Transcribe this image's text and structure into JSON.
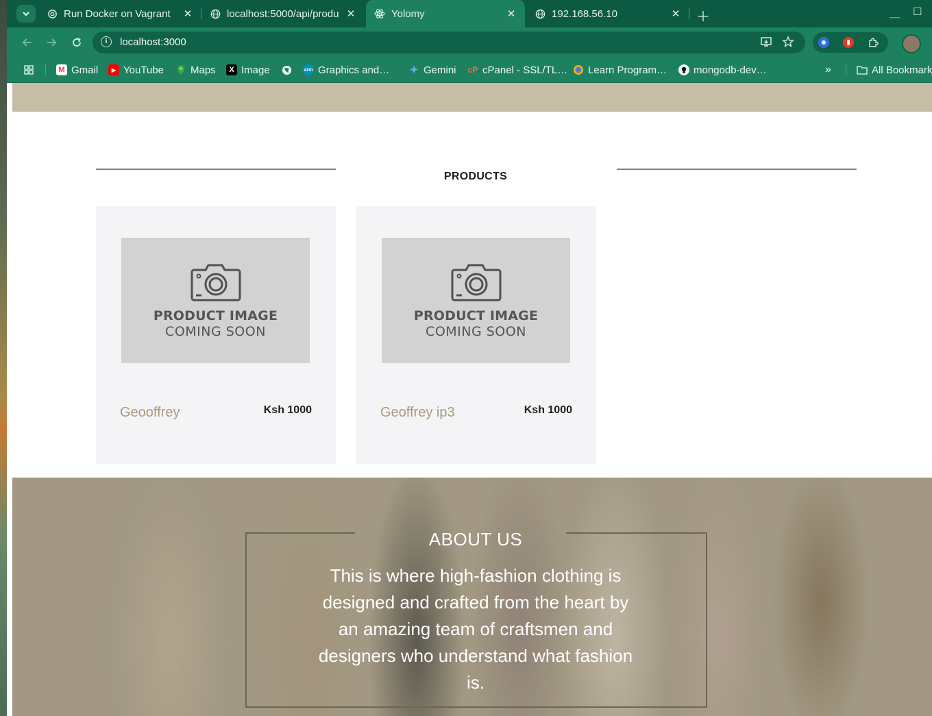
{
  "browser": {
    "tabs": [
      {
        "title": "Run Docker on Vagrant",
        "icon": "chatgpt-icon",
        "active": false
      },
      {
        "title": "localhost:5000/api/produ",
        "icon": "globe-icon",
        "active": false
      },
      {
        "title": "Yolomy",
        "icon": "react-icon",
        "active": true
      },
      {
        "title": "192.168.56.10",
        "icon": "globe-icon",
        "active": false
      }
    ],
    "url": "localhost:3000",
    "bookmarks": [
      {
        "label": "Gmail",
        "icon": "gmail-icon"
      },
      {
        "label": "YouTube",
        "icon": "youtube-icon"
      },
      {
        "label": "Maps",
        "icon": "maps-icon"
      },
      {
        "label": "Image",
        "icon": "x-icon"
      },
      {
        "label": "",
        "icon": "globe-icon"
      },
      {
        "label": "Graphics and…",
        "icon": "arm-icon"
      },
      {
        "label": "Gemini",
        "icon": "gemini-icon"
      },
      {
        "label": "cPanel - SSL/TL…",
        "icon": "cpanel-icon"
      },
      {
        "label": "Learn Program…",
        "icon": "learn-icon"
      },
      {
        "label": "mongodb-dev…",
        "icon": "github-icon"
      }
    ],
    "all_bookmarks": "All Bookmarks",
    "overflow": "»",
    "colors": {
      "frame": "#0c5a42",
      "toolbar": "#1d8160"
    }
  },
  "page": {
    "section_title": "PRODUCTS",
    "products": [
      {
        "name": "Geooffrey",
        "price": "Ksh 1000",
        "placeholder_line1": "PRODUCT IMAGE",
        "placeholder_line2": "COMING SOON"
      },
      {
        "name": "Geoffrey ip3",
        "price": "Ksh 1000",
        "placeholder_line1": "PRODUCT IMAGE",
        "placeholder_line2": "COMING SOON"
      }
    ],
    "about": {
      "title": "ABOUT US",
      "text": "This is where high-fashion clothing is designed and crafted from the heart by an amazing team of craftsmen and designers who understand what fashion is."
    },
    "colors": {
      "band": "#c6bda7",
      "line": "#8b7d5f",
      "card": "#f4f4f6",
      "name": "#a99a7a"
    }
  }
}
